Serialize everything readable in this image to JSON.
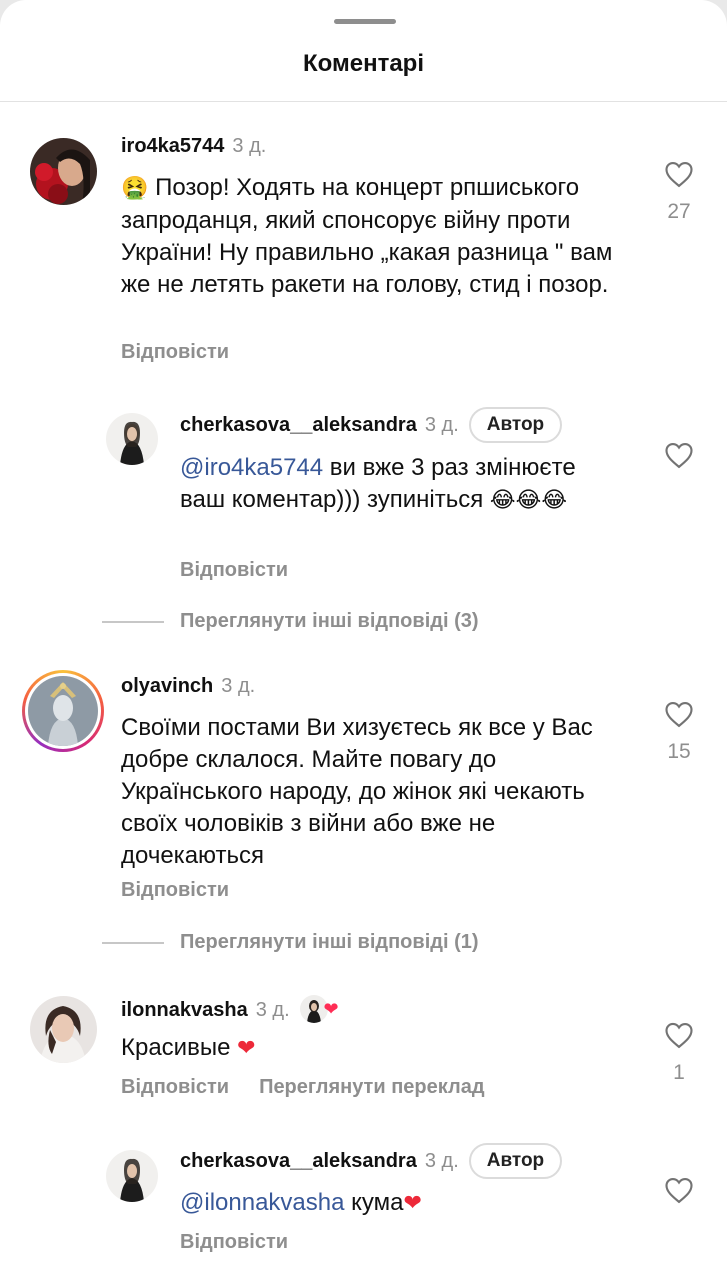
{
  "header": {
    "title": "Коментарі"
  },
  "comments": [
    {
      "username": "iro4ka5744",
      "time": "3 д.",
      "emoji": "🤮",
      "text": " Позор! Ходять на концерт рпшиського запроданця, який спонсорує війну проти України! Ну правильно „какая разница \" вам же не летять ракети на голову, стид і позор.",
      "reply_label": "Відповісти",
      "likes": "27"
    },
    {
      "username": "cherkasova__aleksandra",
      "time": "3 д.",
      "badge": "Автор",
      "mention": "@iro4ka5744",
      "text": " ви вже 3 раз змінюєте ваш коментар))) зупиніться ",
      "emoji": "😂😂😂",
      "reply_label": "Відповісти",
      "likes": ""
    },
    {
      "username": "olyavinch",
      "time": "3 д.",
      "text": "Своїми постами Ви хизуєтесь як все у Вас добре склалося. Майте повагу до Українського народу, до жінок які чекають своїх чоловіків з війни або вже не дочекаються",
      "reply_label": "Відповісти",
      "likes": "15"
    },
    {
      "username": "ilonnakvasha",
      "time": "3 д.",
      "text": "Красивые ",
      "emoji": "❤",
      "reply_label": "Відповісти",
      "translate_label": "Переглянути переклад",
      "likes": "1"
    },
    {
      "username": "cherkasova__aleksandra",
      "time": "3 д.",
      "badge": "Автор",
      "mention": "@ilonnakvasha",
      "text": " кума",
      "emoji": "❤",
      "reply_label": "Відповісти",
      "likes": ""
    }
  ],
  "view_replies": [
    {
      "label": "Переглянути інші відповіді (3)"
    },
    {
      "label": "Переглянути інші відповіді (1)"
    }
  ],
  "icons": {
    "like": "heart-outline-icon",
    "liked_by_author": "heart-filled-icon"
  },
  "colors": {
    "mention": "#385898",
    "muted": "#8e8e8e",
    "heart": "#ed2939"
  }
}
